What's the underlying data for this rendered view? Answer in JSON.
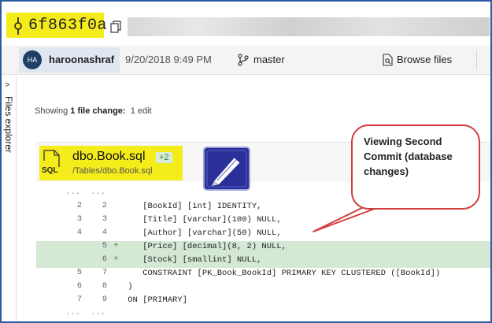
{
  "commit": {
    "hash": "6f863f0a"
  },
  "author": {
    "initials": "HA",
    "name": "haroonashraf",
    "date": "9/20/2018 9:49 PM",
    "branch": "master",
    "browse_label": "Browse files"
  },
  "side_panel": {
    "chevron": ">",
    "label": "Files explorer"
  },
  "summary": {
    "prefix": "Showing ",
    "count": "1 file change:",
    "edits": "1 edit"
  },
  "file": {
    "icon_label": "SQL",
    "name": "dbo.Book.sql",
    "badge": "+2",
    "path": "/Tables/dbo.Book.sql"
  },
  "diff": {
    "lines": [
      {
        "old": "...",
        "new": "...",
        "mark": "",
        "code": "",
        "type": "ellipsis"
      },
      {
        "old": "2",
        "new": "2",
        "mark": "",
        "code": "    [BookId] [int] IDENTITY,",
        "type": "context"
      },
      {
        "old": "3",
        "new": "3",
        "mark": "",
        "code": "    [Title] [varchar](100) NULL,",
        "type": "context"
      },
      {
        "old": "4",
        "new": "4",
        "mark": "",
        "code": "    [Author] [varchar](50) NULL,",
        "type": "context"
      },
      {
        "old": "",
        "new": "5",
        "mark": "+",
        "code": "    [Price] [decimal](8, 2) NULL,",
        "type": "added"
      },
      {
        "old": "",
        "new": "6",
        "mark": "+",
        "code": "    [Stock] [smallint] NULL,",
        "type": "added"
      },
      {
        "old": "5",
        "new": "7",
        "mark": "",
        "code": "    CONSTRAINT [PK_Book_BookId] PRIMARY KEY CLUSTERED ([BookId])",
        "type": "context"
      },
      {
        "old": "6",
        "new": "8",
        "mark": "",
        "code": " )",
        "type": "context"
      },
      {
        "old": "7",
        "new": "9",
        "mark": "",
        "code": " ON [PRIMARY]",
        "type": "context"
      },
      {
        "old": "...",
        "new": "...",
        "mark": "",
        "code": "",
        "type": "ellipsis"
      }
    ]
  },
  "callout": {
    "text": "Viewing Second\nCommit (database\nchanges)"
  },
  "colors": {
    "highlight": "#f5ec1c",
    "added_bg": "#d4e8d4",
    "callout_border": "#d23c3c",
    "avatar_bg": "#1f3f66"
  },
  "icons": [
    "commit-icon",
    "copy-icon",
    "branch-icon",
    "browse-files-icon",
    "sql-file-icon",
    "pen-logo-icon",
    "chevron-right-icon"
  ]
}
